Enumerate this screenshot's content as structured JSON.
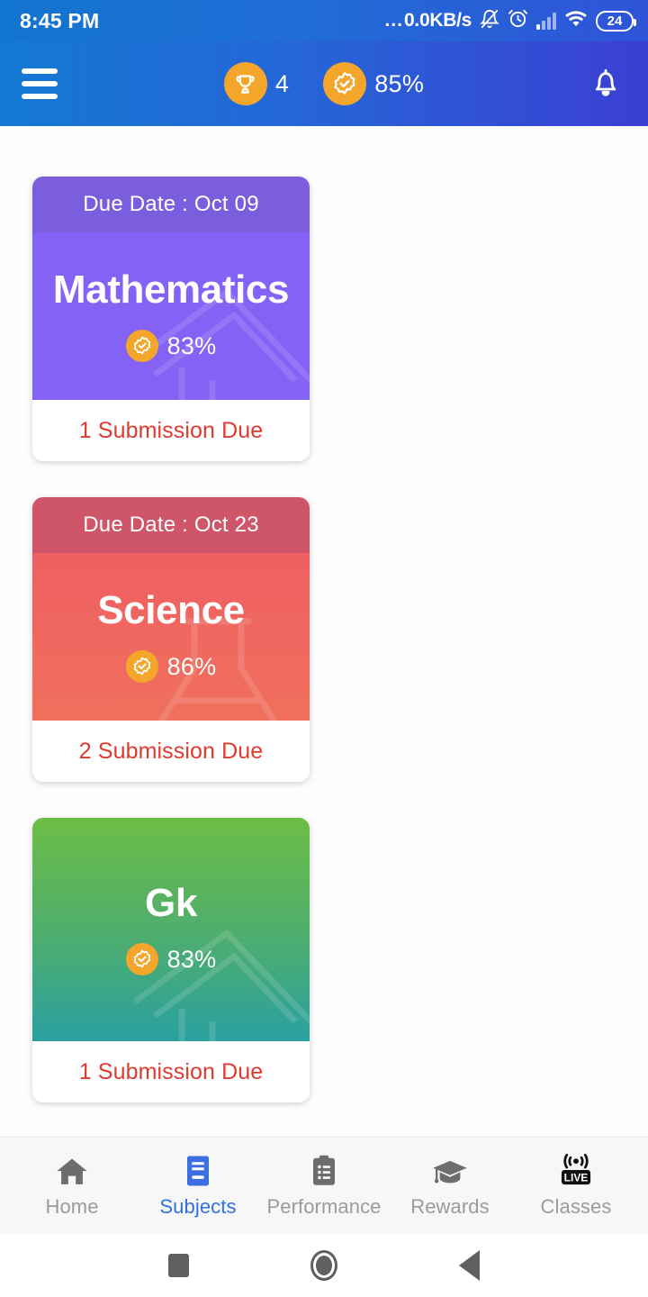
{
  "status_bar": {
    "time": "8:45 PM",
    "network_dots": "...",
    "network_speed": "0.0KB/s",
    "icons": [
      "bell-muted-icon",
      "alarm-icon",
      "signal-icon",
      "wifi-icon"
    ],
    "battery_level": "24"
  },
  "app_bar": {
    "menu_icon": "hamburger-icon",
    "badges": [
      {
        "icon": "trophy-icon",
        "value": "4"
      },
      {
        "icon": "verified-check-icon",
        "value": "85%"
      }
    ],
    "notification_icon": "bell-icon"
  },
  "subjects": [
    {
      "name": "Mathematics",
      "due_label": "Due Date : Oct 09",
      "has_due_header": true,
      "score": "83%",
      "score_icon": "verified-check-icon",
      "submission_text": "1 Submission Due",
      "watermark": "geometry-tools-icon",
      "colors": {
        "header": "#7b5ede",
        "body": "#8362f5",
        "footer_text": "#e03a30"
      }
    },
    {
      "name": "Science",
      "due_label": "Due Date : Oct 23",
      "has_due_header": true,
      "score": "86%",
      "score_icon": "verified-check-icon",
      "submission_text": "2 Submission Due",
      "watermark": "flask-icon",
      "colors": {
        "header": "#cf5569",
        "body": "#ef6666",
        "footer_text": "#e03a30"
      }
    },
    {
      "name": "Gk",
      "due_label": "",
      "has_due_header": false,
      "score": "83%",
      "score_icon": "verified-check-icon",
      "submission_text": "1 Submission Due",
      "watermark": "geometry-tools-icon",
      "colors": {
        "header": "",
        "body": "#5bb45c",
        "footer_text": "#e03a30"
      }
    }
  ],
  "bottom_nav": {
    "active": "Subjects",
    "items": [
      {
        "label": "Home",
        "icon": "home-icon"
      },
      {
        "label": "Subjects",
        "icon": "book-icon"
      },
      {
        "label": "Performance",
        "icon": "clipboard-list-icon"
      },
      {
        "label": "Rewards",
        "icon": "graduation-cap-icon"
      },
      {
        "label": "Classes",
        "icon": "live-broadcast-icon"
      }
    ]
  },
  "system_nav": {
    "items": [
      {
        "name": "recents-button",
        "icon": "square-icon"
      },
      {
        "name": "home-button",
        "icon": "circle-icon"
      },
      {
        "name": "back-button",
        "icon": "triangle-left-icon"
      }
    ]
  },
  "theme": {
    "appbar_gradient_start": "#1479d2",
    "appbar_gradient_end": "#3b3fd2",
    "accent_orange": "#f3a62a",
    "active_nav_blue": "#2f6fe4",
    "due_red": "#e03a30"
  }
}
